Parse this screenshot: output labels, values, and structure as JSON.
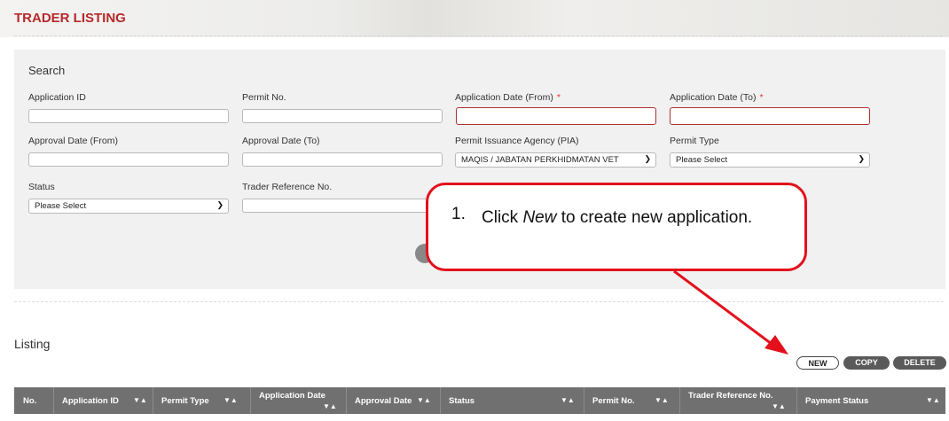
{
  "header": {
    "title": "TRADER LISTING"
  },
  "search": {
    "title": "Search",
    "fields": {
      "application_id": "Application ID",
      "permit_no": "Permit No.",
      "app_date_from": "Application Date (From)",
      "app_date_to": "Application Date (To)",
      "required_mark": "*",
      "approval_from": "Approval Date (From)",
      "approval_to": "Approval Date (To)",
      "pia": "Permit Issuance Agency (PIA)",
      "permit_type": "Permit Type",
      "status": "Status",
      "trader_ref": "Trader Reference No."
    },
    "values": {
      "pia": "MAQIS / JABATAN PERKHIDMATAN VET",
      "permit_type": "Please Select",
      "status": "Please Select"
    }
  },
  "callout": {
    "number": "1.",
    "text_prefix": "Click ",
    "text_em": "New",
    "text_suffix": " to create new application."
  },
  "listing": {
    "title": "Listing",
    "buttons": {
      "new": "NEW",
      "copy": "COPY",
      "delete": "DELETE"
    },
    "columns": [
      "No.",
      "Application ID",
      "Permit Type",
      "Application Date",
      "Approval Date",
      "Status",
      "Permit No.",
      "Trader Reference No.",
      "Payment Status"
    ],
    "sort_glyph": "▼▲"
  },
  "colors": {
    "accent": "#b62a2a",
    "callout_border": "#e3101c",
    "table_header": "#707070"
  }
}
